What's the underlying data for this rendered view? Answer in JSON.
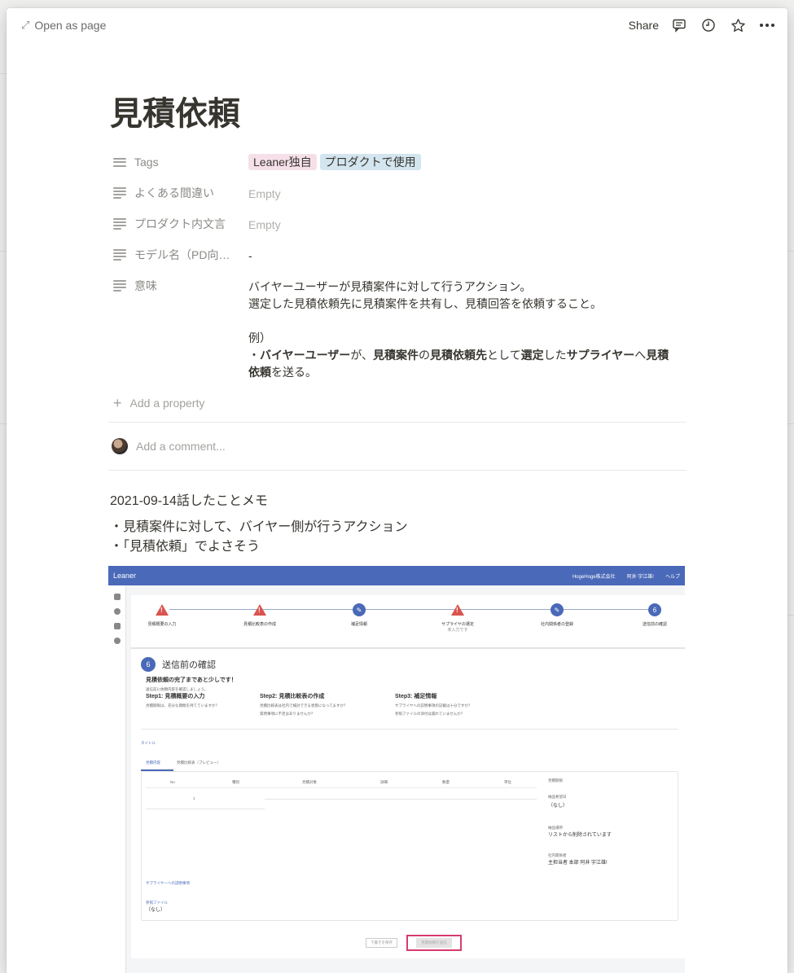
{
  "topbar": {
    "open_as_page": "Open as page",
    "share": "Share"
  },
  "page": {
    "title": "見積依頼",
    "properties": [
      {
        "name": "Tags",
        "icon": "list-icon",
        "type": "tags"
      },
      {
        "name": "よくある間違い",
        "icon": "text-icon",
        "value": "Empty",
        "empty": true
      },
      {
        "name": "プロダクト内文言",
        "icon": "text-icon",
        "value": "Empty",
        "empty": true
      },
      {
        "name": "モデル名（PD向…",
        "icon": "text-icon",
        "value": "-"
      },
      {
        "name": "意味",
        "icon": "text-icon",
        "type": "meaning"
      }
    ],
    "tags": [
      "Leaner独自",
      "プロダクトで使用"
    ],
    "meaning": {
      "line1": "バイヤーユーザーが見積案件に対して行うアクション。",
      "line2": "選定した見積依頼先に見積案件を共有し、見積回答を依頼すること。",
      "example_label": "例）",
      "ex_parts": [
        "・",
        "バイヤーユーザー",
        "が、",
        "見積案件",
        "の",
        "見積依頼先",
        "として",
        "選定",
        "した",
        "サプライヤー",
        "へ",
        "見積",
        "依頼",
        "を送る。"
      ]
    },
    "add_property": "Add a property",
    "add_comment": "Add a comment...",
    "body": [
      "2021-09-14話したことメモ",
      "・見積案件に対して、バイヤー側が行うアクション",
      "・「見積依頼」でよさそう"
    ]
  },
  "screenshot": {
    "brand": "Leaner",
    "company": "HogeHoge株式会社",
    "user": "阿井 宇江雄!",
    "help": "ヘルプ",
    "steps": [
      {
        "label": "見積概要の入力",
        "state": "warning"
      },
      {
        "label": "見積比較表の作成",
        "state": "warning"
      },
      {
        "label": "補足情報",
        "state": "edit"
      },
      {
        "label": "サプライヤの選定",
        "sub": "未入力です",
        "state": "warning"
      },
      {
        "label": "社内関係者の登録",
        "state": "edit"
      },
      {
        "label": "送信前の確認",
        "state": "current",
        "num": "6"
      }
    ],
    "section_num": "6",
    "section_title": "送信前の確認",
    "lead": "見積依頼の完了まであと少しです！",
    "lead_sub": "送信前に依頼内容を確認しましょう。",
    "checks": [
      {
        "title": "Step1: 見積概要の入力",
        "lines": [
          "見積期限は、充分な期間を持てていますか？"
        ]
      },
      {
        "title": "Step2: 見積比較表の作成",
        "lines": [
          "見積比較表は社内で検討できる状態になってますか？",
          "質問事項に不足はありませんか？"
        ]
      },
      {
        "title": "Step3: 補足情報",
        "lines": [
          "サプライヤへの説明事項の記載は十分ですか？",
          "参照ファイルの添付は漏れていませんか？"
        ]
      }
    ],
    "title_label": "タイトル",
    "tabs": [
      "見積内容",
      "見積比較表（プレビュー）"
    ],
    "table_headers": [
      "No",
      "種別",
      "見積対象",
      "詳細",
      "数量",
      "単位"
    ],
    "row_no": "1",
    "right_panel": [
      {
        "label": "見積期限",
        "value": ""
      },
      {
        "label": "納品希望日",
        "value": "（なし）"
      },
      {
        "label": "納品場所",
        "value": "リストから削除されています"
      },
      {
        "label": "社内関係者",
        "value": "主担当者 本部 阿井 宇江雄!"
      }
    ],
    "supplier_note": "サプライヤーへの説明事項",
    "ref_file_label": "参照ファイル",
    "ref_file_value": "（なし）",
    "btn_draft": "下書きを保存",
    "btn_send": "見積依頼を送信"
  }
}
